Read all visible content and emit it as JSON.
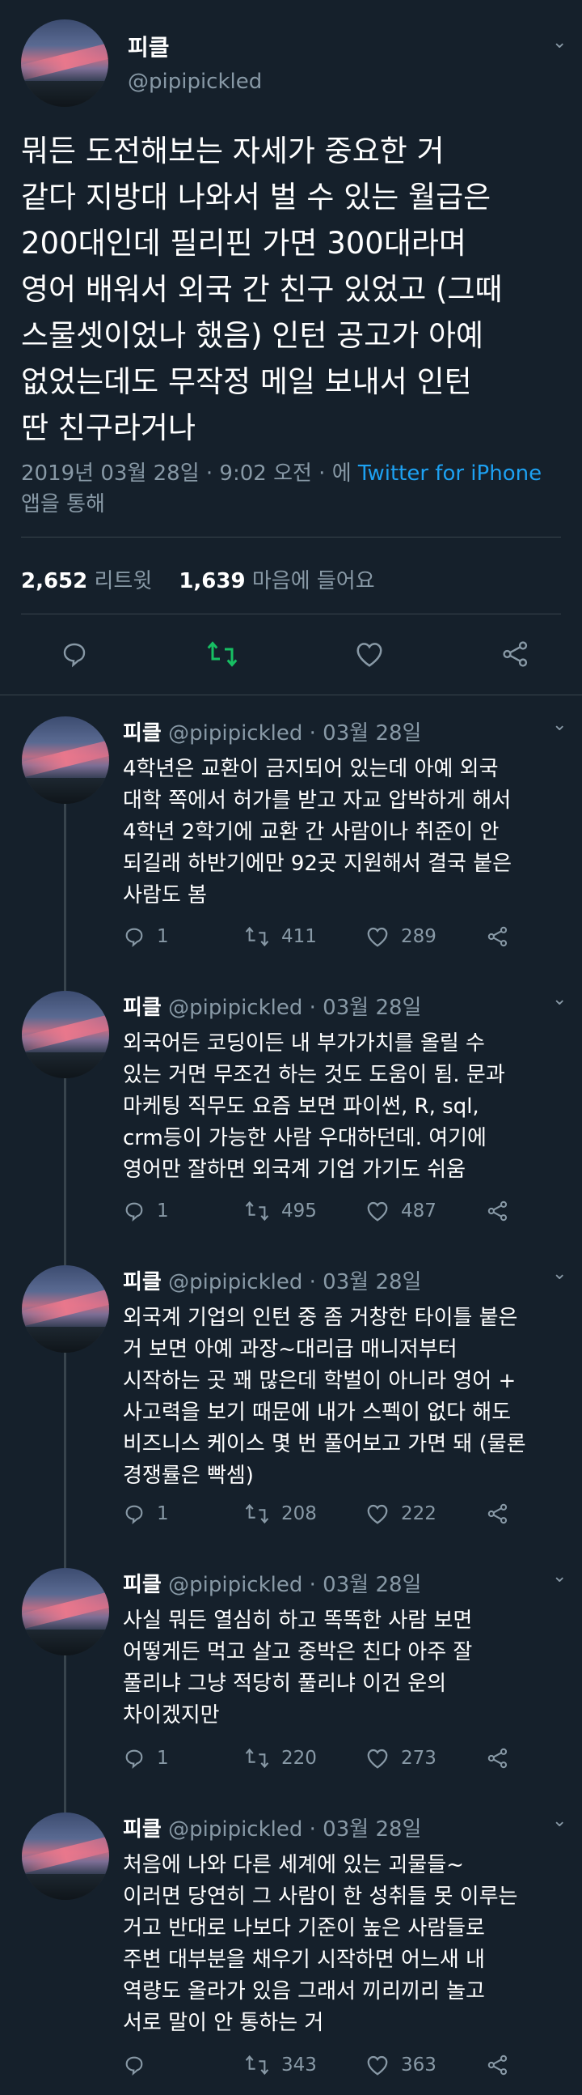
{
  "main_tweet": {
    "display_name": "피클",
    "handle": "@pipipickled",
    "text_lines": [
      "뭐든 도전해보는 자세가 중요한 거",
      "같다 지방대 나와서 벌 수 있는 월급은",
      "200대인데 필리핀 가면 300대라며",
      "영어 배워서 외국 간 친구 있었고 (그때",
      "스물셋이었나 했음) 인턴 공고가 아예",
      "없었는데도 무작정 메일 보내서 인턴",
      "딴 친구라거나"
    ],
    "meta_prefix": "2019년 03월 28일 · 9:02 오전 · 에 ",
    "source_link": "Twitter for iPhone",
    "meta_suffix": "앱을 통해",
    "retweet_count": "2,652",
    "retweet_label": "리트윗",
    "like_count": "1,639",
    "like_label": "마음에 들어요"
  },
  "replies": [
    {
      "display_name": "피클",
      "handle": "@pipipickled",
      "date": "· 03월 28일",
      "text_lines": [
        "4학년은 교환이 금지되어 있는데 아예 외국",
        "대학 쪽에서 허가를 받고 자교 압박하게 해서",
        "4학년 2학기에 교환 간 사람이나 취준이 안",
        "되길래 하반기에만 92곳 지원해서 결국 붙은",
        "사람도 봄"
      ],
      "replies": "1",
      "retweets": "411",
      "likes": "289"
    },
    {
      "display_name": "피클",
      "handle": "@pipipickled",
      "date": "· 03월 28일",
      "text_lines": [
        "외국어든 코딩이든 내 부가가치를 올릴 수",
        "있는 거면 무조건 하는 것도 도움이 됨. 문과",
        "마케팅 직무도 요즘 보면 파이썬, R, sql,",
        "crm등이 가능한 사람 우대하던데. 여기에",
        "영어만 잘하면 외국계 기업 가기도 쉬움"
      ],
      "replies": "1",
      "retweets": "495",
      "likes": "487"
    },
    {
      "display_name": "피클",
      "handle": "@pipipickled",
      "date": "· 03월 28일",
      "text_lines": [
        "외국계 기업의 인턴 중 좀 거창한 타이틀 붙은",
        "거 보면 아예 과장~대리급 매니저부터",
        "시작하는 곳 꽤 많은데 학벌이 아니라 영어 +",
        "사고력을 보기 때문에 내가 스펙이 없다 해도",
        "비즈니스 케이스 몇 번 풀어보고 가면 돼 (물론",
        "경쟁률은 빡셈)"
      ],
      "replies": "1",
      "retweets": "208",
      "likes": "222"
    },
    {
      "display_name": "피클",
      "handle": "@pipipickled",
      "date": "· 03월 28일",
      "text_lines": [
        "사실 뭐든 열심히 하고 똑똑한 사람 보면",
        "어떻게든 먹고 살고 중박은 친다 아주 잘",
        "풀리냐 그냥 적당히 풀리냐 이건 운의",
        "차이겠지만"
      ],
      "replies": "1",
      "retweets": "220",
      "likes": "273"
    },
    {
      "display_name": "피클",
      "handle": "@pipipickled",
      "date": "· 03월 28일",
      "text_lines": [
        "처음에 나와 다른 세계에 있는 괴물들~",
        "이러면 당연히 그 사람이 한 성취들 못 이루는",
        "거고 반대로 나보다 기준이 높은 사람들로",
        "주변 대부분을 채우기 시작하면 어느새 내",
        "역량도 올라가 있음 그래서 끼리끼리 놀고",
        "서로 말이 안 통하는 거"
      ],
      "replies": "",
      "retweets": "343",
      "likes": "363"
    }
  ],
  "colors": {
    "background": "#15202b",
    "text": "#ffffff",
    "muted": "#8899a6",
    "link": "#1da1f2",
    "retweet_active": "#17bf63",
    "divider": "#38444d"
  }
}
